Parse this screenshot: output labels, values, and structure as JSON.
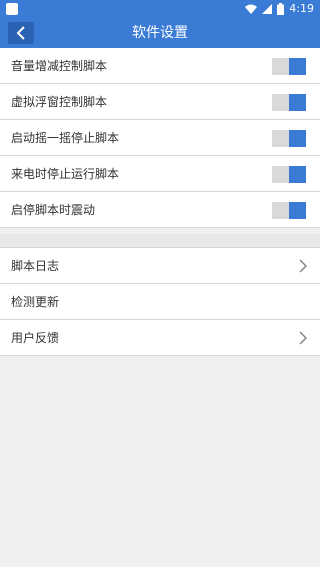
{
  "status_bar": {
    "time": "4:19",
    "battery_level": 100
  },
  "app_bar": {
    "title": "软件设置"
  },
  "settings": {
    "toggles": [
      {
        "label": "音量增减控制脚本",
        "on": true
      },
      {
        "label": "虚拟浮窗控制脚本",
        "on": true
      },
      {
        "label": "启动摇一摇停止脚本",
        "on": true
      },
      {
        "label": "来电时停止运行脚本",
        "on": true
      },
      {
        "label": "启停脚本时震动",
        "on": true
      }
    ],
    "links": [
      {
        "label": "脚本日志",
        "has_chevron": true
      },
      {
        "label": "检测更新",
        "has_chevron": false
      },
      {
        "label": "用户反馈",
        "has_chevron": true
      }
    ]
  },
  "colors": {
    "accent": "#3a7bd5",
    "toggle_track": "#d9d9d9",
    "background": "#f0f0f0"
  }
}
